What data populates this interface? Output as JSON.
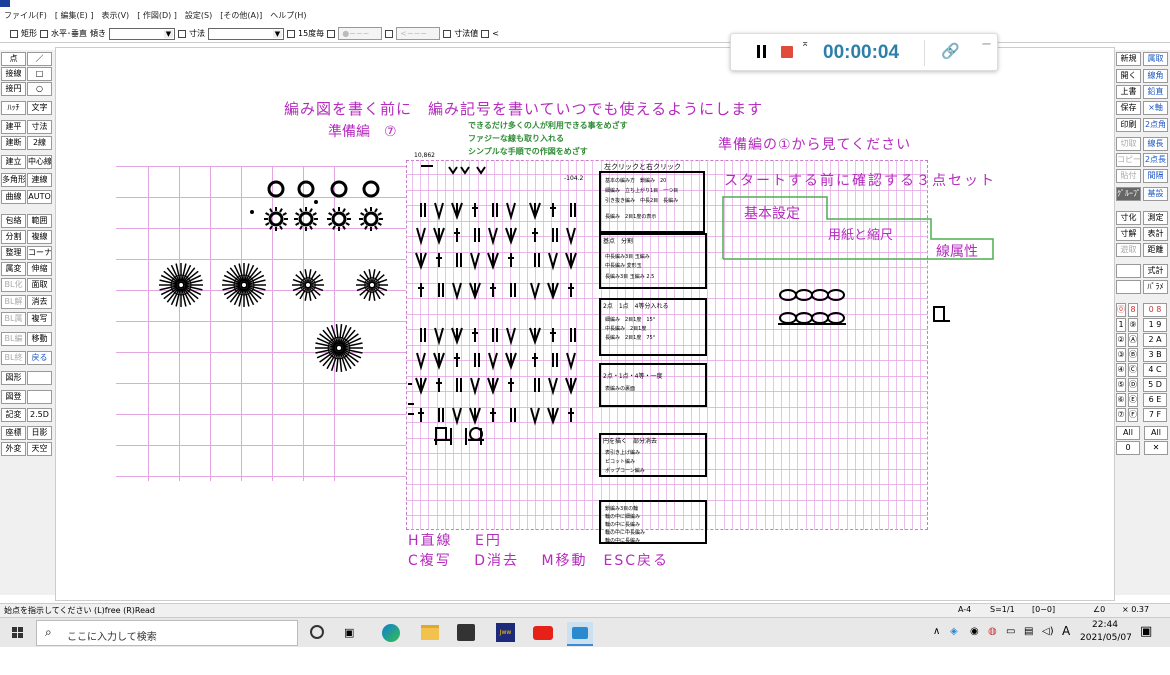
{
  "menu": {
    "items": [
      "ファイル(F)",
      "[ 編集(E) ]",
      "表示(V)",
      "[ 作図(D) ]",
      "設定(S)",
      "[その他(A)]",
      "ヘルプ(H)"
    ]
  },
  "toolbar": {
    "rect_label": "矩形",
    "hv_label": "水平･垂直",
    "slope_label": "傾き",
    "dim_label": "寸法",
    "deg15_label": "15度毎",
    "dimval_label": "寸法値",
    "lt_label": "<"
  },
  "left_buttons": [
    {
      "label": "点",
      "state": "normal"
    },
    {
      "label": "／",
      "state": "normal"
    },
    {
      "label": "接線",
      "state": "normal"
    },
    {
      "label": "□",
      "state": "normal"
    },
    {
      "label": "接円",
      "state": "normal"
    },
    {
      "label": "○",
      "state": "normal"
    },
    {
      "label": "ﾊｯﾁ",
      "state": "normal"
    },
    {
      "label": "文字",
      "state": "normal"
    },
    {
      "label": "建平",
      "state": "normal"
    },
    {
      "label": "寸法",
      "state": "normal"
    },
    {
      "label": "建断",
      "state": "normal"
    },
    {
      "label": "2線",
      "state": "normal"
    },
    {
      "label": "建立",
      "state": "normal"
    },
    {
      "label": "中心線",
      "state": "normal"
    },
    {
      "label": "多角形",
      "state": "normal"
    },
    {
      "label": "連線",
      "state": "normal"
    },
    {
      "label": "曲線",
      "state": "normal"
    },
    {
      "label": "AUTO",
      "state": "normal"
    },
    {
      "label": "包絡",
      "state": "normal"
    },
    {
      "label": "範囲",
      "state": "normal"
    },
    {
      "label": "分割",
      "state": "normal"
    },
    {
      "label": "複線",
      "state": "normal"
    },
    {
      "label": "整理",
      "state": "normal"
    },
    {
      "label": "コーナー",
      "state": "normal"
    },
    {
      "label": "属変",
      "state": "normal"
    },
    {
      "label": "伸縮",
      "state": "normal"
    },
    {
      "label": "BL化",
      "state": "disabled"
    },
    {
      "label": "面取",
      "state": "normal"
    },
    {
      "label": "BL解",
      "state": "disabled"
    },
    {
      "label": "消去",
      "state": "normal"
    },
    {
      "label": "BL属",
      "state": "disabled"
    },
    {
      "label": "複写",
      "state": "normal"
    },
    {
      "label": "BL編",
      "state": "disabled"
    },
    {
      "label": "移動",
      "state": "normal"
    },
    {
      "label": "BL終",
      "state": "disabled"
    },
    {
      "label": "戻る",
      "state": "active"
    },
    {
      "label": "図形",
      "state": "normal"
    },
    {
      "label": "",
      "state": "normal"
    },
    {
      "label": "図登",
      "state": "normal"
    },
    {
      "label": "",
      "state": "blank"
    },
    {
      "label": "記変",
      "state": "normal"
    },
    {
      "label": "2.5D",
      "state": "normal"
    },
    {
      "label": "座標",
      "state": "normal"
    },
    {
      "label": "日影",
      "state": "normal"
    },
    {
      "label": "外変",
      "state": "normal"
    },
    {
      "label": "天空",
      "state": "normal"
    }
  ],
  "right_buttons": [
    {
      "label": "新規",
      "state": "normal"
    },
    {
      "label": "属取",
      "state": "blue"
    },
    {
      "label": "開く",
      "state": "normal"
    },
    {
      "label": "線角",
      "state": "blue"
    },
    {
      "label": "上書",
      "state": "normal"
    },
    {
      "label": "鉛直",
      "state": "blue"
    },
    {
      "label": "保存",
      "state": "normal"
    },
    {
      "label": "×軸",
      "state": "blue"
    },
    {
      "label": "印刷",
      "state": "normal"
    },
    {
      "label": "2点角",
      "state": "blue"
    },
    {
      "label": "切取",
      "state": "disabled"
    },
    {
      "label": "線長",
      "state": "blue"
    },
    {
      "label": "コピー",
      "state": "disabled"
    },
    {
      "label": "2点長",
      "state": "blue"
    },
    {
      "label": "貼付",
      "state": "disabled"
    },
    {
      "label": "間隔",
      "state": "blue"
    },
    {
      "label": "ｸﾞﾙｰﾌﾟ",
      "state": "dark"
    },
    {
      "label": "基設",
      "state": "blue"
    },
    {
      "label": "寸化",
      "state": "normal"
    },
    {
      "label": "測定",
      "state": "normal"
    },
    {
      "label": "寸解",
      "state": "normal"
    },
    {
      "label": "表計",
      "state": "normal"
    },
    {
      "label": "遊取",
      "state": "disabled"
    },
    {
      "label": "距離",
      "state": "normal"
    },
    {
      "label": "",
      "state": "normal"
    },
    {
      "label": "式計",
      "state": "normal"
    },
    {
      "label": "",
      "state": "normal"
    },
    {
      "label": "ﾊﾟﾗﾒ",
      "state": "normal"
    }
  ],
  "layer_buttons": {
    "rows": [
      [
        "⓪",
        "8",
        "0 8"
      ],
      [
        "1",
        "⑨",
        "1 9"
      ],
      [
        "②",
        "Ⓐ",
        "2 A"
      ],
      [
        "③",
        "Ⓑ",
        "3 B"
      ],
      [
        "④",
        "Ⓒ",
        "4 C"
      ],
      [
        "⑤",
        "Ⓓ",
        "5 D"
      ],
      [
        "⑥",
        "Ⓔ",
        "6 E"
      ],
      [
        "⑦",
        "Ⓕ",
        "7 F"
      ]
    ],
    "all_left": "All",
    "all_right": "All",
    "zero": "0",
    "x_mark": "✕"
  },
  "recorder": {
    "time": "00:00:04",
    "pause_icon": "pause-icon",
    "stop_icon": "stop-icon",
    "link_icon": "link-icon",
    "minimize": "−"
  },
  "canvas": {
    "title1": "編み図を書く前に　編み記号を書いていつでも使えるようにします",
    "title2": "準備編　⑦",
    "green1": "できるだけ多くの人が利用できる事をめざす",
    "green2": "ファジーな線も取り入れる",
    "green3": "シンプルな手順での作図をめざす",
    "purple_r1": "準備編の①から見てください",
    "purple_r2": "スタートする前に確認する３点セット",
    "box1": "基本設定",
    "box2": "用紙と縮尺",
    "box3": "線属性",
    "shortcut1": "H直線　 E円",
    "shortcut2": "C複写　 D消去　 M移動　ESC戻る",
    "top_num": "10,862",
    "click_label": "左クリックと右クリック",
    "small_num": "-104.2",
    "sec1_title": "基点　分割",
    "sec2_title": "2点　1点　4等分入れる",
    "sec3_title": "2点・1点・4等・一度",
    "sec4_title": "円を描く　部分消去"
  },
  "status": {
    "message": "始点を指示してください (L)free (R)Read",
    "paper": "A-4",
    "scale": "S=1/1",
    "layer": "[0−0]",
    "angle": "∠0",
    "zoom": "× 0.37"
  },
  "taskbar": {
    "search_placeholder": "ここに入力して検索",
    "time": "22:44",
    "date": "2021/05/07",
    "ime": "A"
  }
}
